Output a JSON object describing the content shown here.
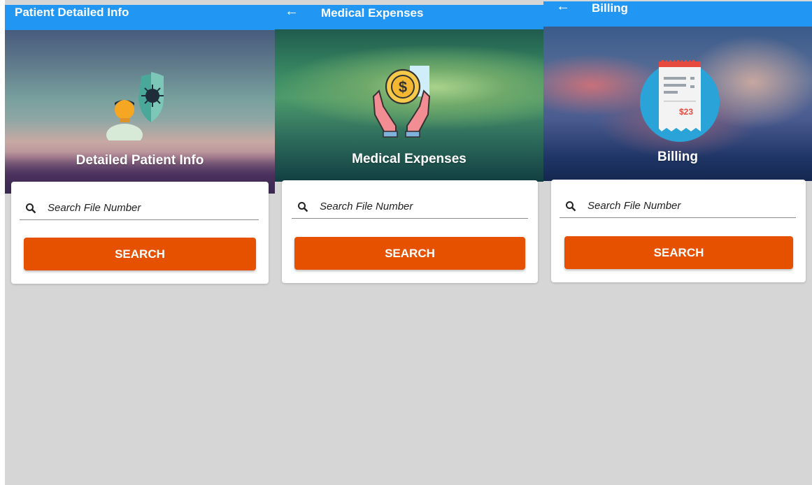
{
  "screens": [
    {
      "app_bar_title": "Patient Detailed Info",
      "banner_title": "Detailed Patient Info",
      "search_placeholder": "Search File Number",
      "search_button": "SEARCH",
      "banner_icon": "patient-shield-virus-icon"
    },
    {
      "back_icon": "←",
      "app_bar_title": "Medical Expenses",
      "banner_title": "Medical Expenses",
      "search_placeholder": "Search File Number",
      "search_button": "SEARCH",
      "banner_icon": "hands-coin-dollar-icon"
    },
    {
      "back_icon": "←",
      "app_bar_title": "Billing",
      "banner_title": "Billing",
      "receipt_amount": "$23",
      "search_placeholder": "Search File Number",
      "search_button": "SEARCH",
      "banner_icon": "receipt-icon"
    }
  ],
  "colors": {
    "app_bar": "#2196f3",
    "search_button": "#e65100",
    "background": "#d6d6d6"
  }
}
